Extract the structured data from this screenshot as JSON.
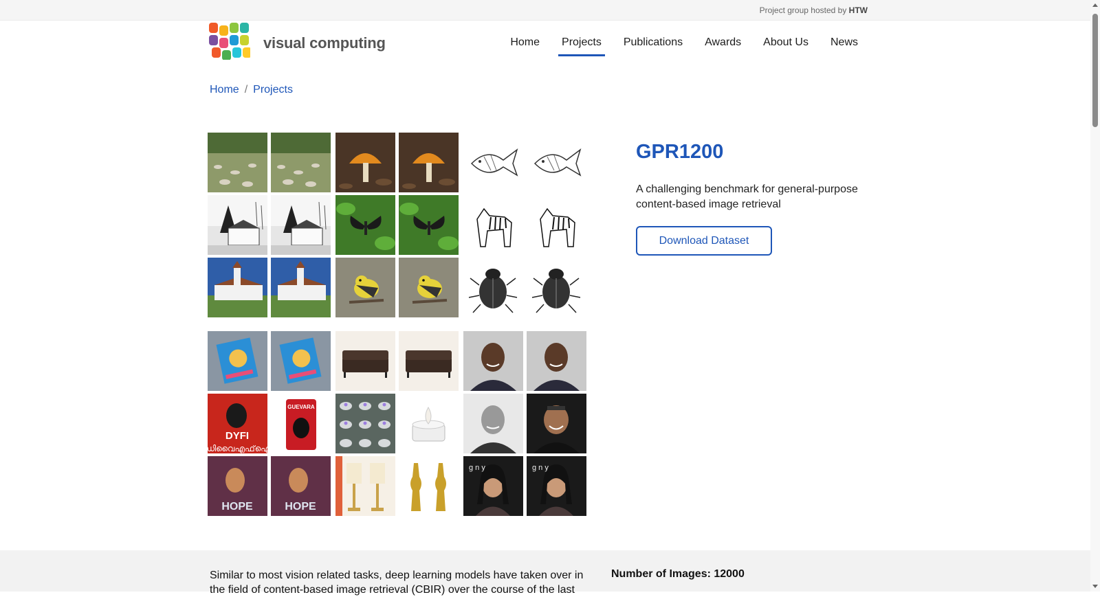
{
  "topbar": {
    "hosted_prefix": "Project group hosted by",
    "hosted_org": "HTW"
  },
  "brand": {
    "name": "visual computing",
    "logo_colors": [
      "#f05a28",
      "#f7b21a",
      "#8dc63f",
      "#2bb5a5",
      "#7a4fa0",
      "#e94e77",
      "#1e9ad6",
      "#c7d22f",
      "#f1592a",
      "#4caf50",
      "#26c6da",
      "#ffca28"
    ]
  },
  "nav": {
    "items": [
      {
        "label": "Home",
        "active": false
      },
      {
        "label": "Projects",
        "active": true
      },
      {
        "label": "Publications",
        "active": false
      },
      {
        "label": "Awards",
        "active": false
      },
      {
        "label": "About Us",
        "active": false
      },
      {
        "label": "News",
        "active": false
      }
    ]
  },
  "breadcrumb": {
    "items": [
      "Home",
      "Projects"
    ],
    "separator": "/"
  },
  "project": {
    "title": "GPR1200",
    "description": "A challenging benchmark for general-purpose content-based image retrieval",
    "download_label": "Download Dataset"
  },
  "mosaic": {
    "tiles": [
      "landscape-stones-icon",
      "landscape-stones-icon",
      "mushroom-icon",
      "mushroom-icon",
      "goldfish-sketch-icon",
      "goldfish-sketch-icon",
      "church-bw-icon",
      "church-bw-icon",
      "butterfly-icon",
      "butterfly-icon",
      "zebra-sketch-icon",
      "zebra-sketch-icon",
      "fortified-church-icon",
      "fortified-church-icon",
      "warbler-bird-icon",
      "warbler-bird-icon",
      "beetle-sketch-icon",
      "beetle-sketch-icon",
      "book-cover-icon",
      "book-cover-icon",
      "sofa-icon",
      "sofa-icon",
      "portrait-man-icon",
      "portrait-man-icon",
      "poster-red-icon",
      "lighter-red-icon",
      "tea-lights-icon",
      "tea-light-single-icon",
      "portrait-bw-man-icon",
      "portrait-man-smile-icon",
      "poster-hope-icon",
      "poster-hope-icon",
      "lamps-icon",
      "candlesticks-gold-icon",
      "portrait-woman-icon",
      "portrait-woman-icon"
    ],
    "tile_texts": {
      "poster_red": "DYFI",
      "poster_red_sub": "ഡിവൈഎഫ്ഐ",
      "lighter": "GUEVARA",
      "poster_hope": "HOPE",
      "woman2_bg": "g n y"
    }
  },
  "details": {
    "intro": "Similar to most vision related tasks, deep learning models have taken over in the field of content-based image retrieval (CBIR) over the course of the last",
    "num_images_label": "Number of Images: 12000"
  }
}
